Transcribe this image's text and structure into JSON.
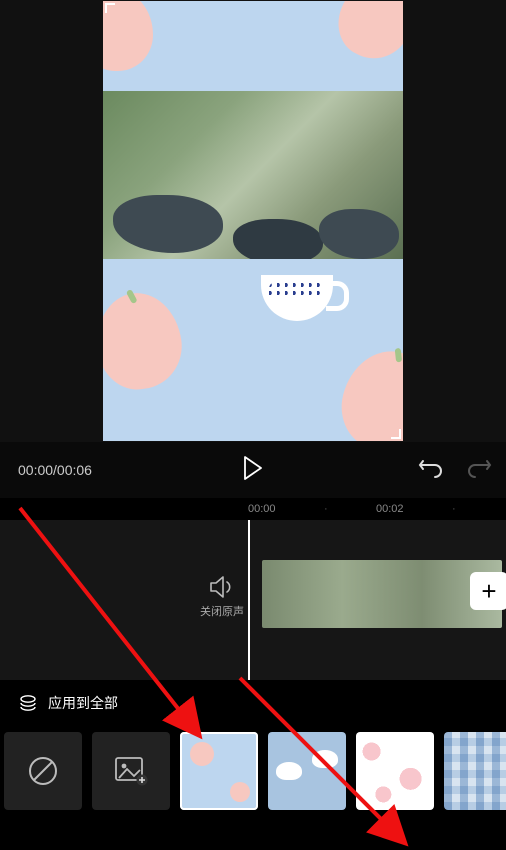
{
  "playback": {
    "current": "00:00",
    "total": "00:06",
    "combined": "00:00/00:06"
  },
  "ruler": {
    "t0": "00:00",
    "t1": "00:02"
  },
  "mute": {
    "label": "关闭原声"
  },
  "addClip": {
    "glyph": "+"
  },
  "applyAll": {
    "label": "应用到全部"
  },
  "backgrounds": {
    "items": [
      {
        "id": "none",
        "kind": "icon"
      },
      {
        "id": "import",
        "kind": "icon"
      },
      {
        "id": "peaches",
        "kind": "pattern",
        "selected": true
      },
      {
        "id": "swans",
        "kind": "pattern"
      },
      {
        "id": "hearts",
        "kind": "pattern"
      },
      {
        "id": "plaid",
        "kind": "pattern"
      }
    ]
  }
}
